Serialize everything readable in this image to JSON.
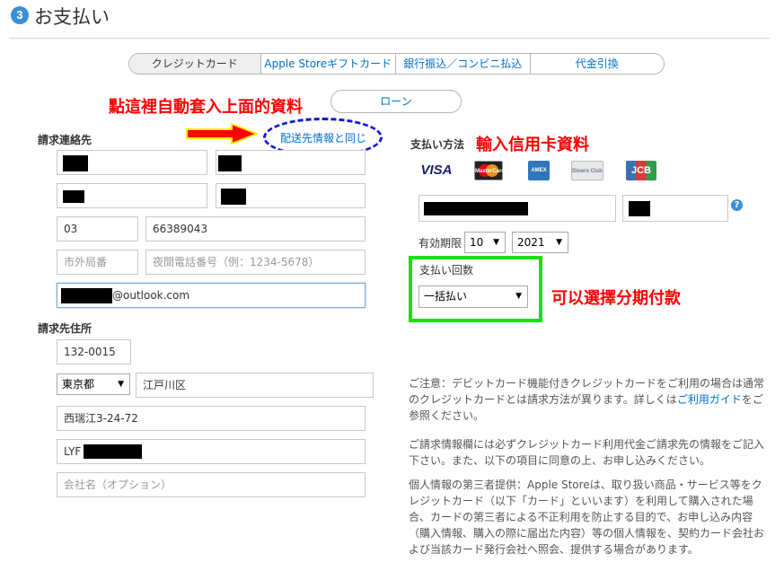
{
  "header": {
    "step_number": "3",
    "title": "お支払い"
  },
  "tabs": [
    "クレジットカード",
    "Apple Storeギフトカード",
    "銀行振込／コンビニ払込",
    "代金引換"
  ],
  "loan_button": "ローン",
  "annotations": {
    "autofill": "點這裡自動套入上面的資料",
    "card_info": "輸入信用卡資料",
    "installment": "可以選擇分期付款"
  },
  "billing_contact": {
    "label": "請求連絡先",
    "same_as_shipping_link": "配送先情報と同じ",
    "phone_area": "03",
    "phone_number": "66389043",
    "night_area_placeholder": "市外局番",
    "night_phone_placeholder": "夜間電話番号（例：1234-5678）",
    "email_suffix": "@outlook.com"
  },
  "billing_address": {
    "label": "請求先住所",
    "postal_code": "132-0015",
    "prefecture": "東京都",
    "city": "江戸川区",
    "street": "西瑞江3-24-72",
    "building": "LYF",
    "company_placeholder": "会社名（オプション）"
  },
  "payment": {
    "label": "支払い方法",
    "card_brands": [
      "VISA",
      "MasterCard",
      "AMEX",
      "Diners Club",
      "JCB"
    ],
    "expiry_label": "有効期限",
    "expiry_month": "10",
    "expiry_year": "2021",
    "installments_label": "支払い回数",
    "installments_value": "一括払い"
  },
  "notice": {
    "p1_before": "ご注意：デビットカード機能付きクレジットカードをご利用の場合は通常のクレジットカードとは請求方法が異ります。詳しくは",
    "p1_link": "ご利用ガイド",
    "p1_after": "をご参照ください。",
    "p2": "ご請求情報欄には必ずクレジットカード利用代金ご請求先の情報をご記入下さい。また、以下の項目に同意の上、お申し込みください。",
    "p3": "個人情報の第三者提供：Apple Storeは、取り扱い商品・サービス等をクレジットカード（以下「カード」といいます）を利用して購入された場合、カードの第三者による不正利用を防止する目的で、お申し込み内容（購入情報、購入の際に届出た内容）等の個人情報を、契約カード会社および当該カード発行会社へ照会、提供する場合があります。"
  },
  "colors": {
    "link": "#0070c9",
    "annotation_red": "#ff0000",
    "ellipse_blue": "#1515e0",
    "highlight_green": "#14e014",
    "step_blue": "#3a8fd6"
  }
}
